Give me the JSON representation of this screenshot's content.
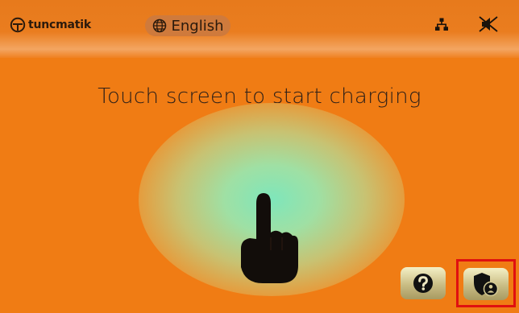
{
  "app": {
    "logo_text": "tuncmatik",
    "logo_icon": "tuncmatik-logo-icon"
  },
  "header": {
    "language": {
      "label": "English",
      "icon": "globe-icon"
    },
    "status_icons": [
      "network-icon",
      "sound-muted-icon"
    ]
  },
  "main": {
    "title": "Touch screen to start charging",
    "illustration_icon": "pointing-hand-icon"
  },
  "footer": {
    "help_button": {
      "icon": "question-icon"
    },
    "privacy_button": {
      "icon": "shield-user-icon",
      "highlighted": true
    }
  },
  "colors": {
    "background": "#f07c14",
    "glow": "#7ee6bb",
    "button": "#d6cc95",
    "highlight": "#e01010",
    "text": "#2d2019"
  }
}
